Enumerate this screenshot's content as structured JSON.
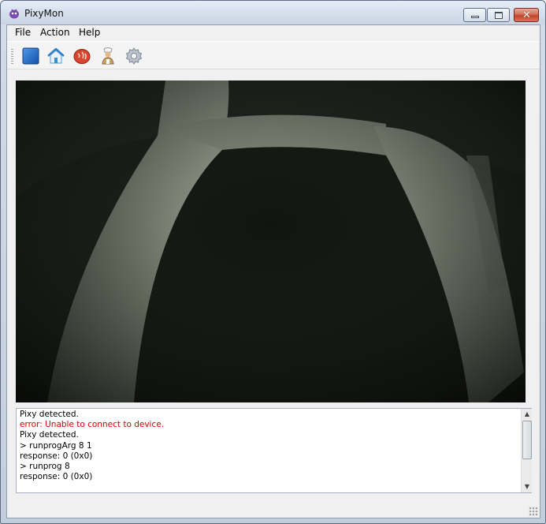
{
  "window": {
    "title": "PixyMon",
    "controls": {
      "minimize": "minimize",
      "maximize": "maximize",
      "close": "close"
    }
  },
  "menu": {
    "items": [
      "File",
      "Action",
      "Help"
    ]
  },
  "toolbar": {
    "buttons": [
      {
        "icon": "stop-square-icon",
        "color": "#1f6fc8"
      },
      {
        "icon": "home-icon",
        "color": "#3a9ad9"
      },
      {
        "icon": "steak-icon",
        "color": "#d9462f"
      },
      {
        "icon": "chef-icon",
        "color": "#c9a36a"
      },
      {
        "icon": "gear-icon",
        "color": "#8c96a3"
      }
    ]
  },
  "console": {
    "lines": [
      {
        "text": "Pixy detected.",
        "type": "normal"
      },
      {
        "text": "error: Unable to connect to device.",
        "type": "error"
      },
      {
        "text": "Pixy detected.",
        "type": "normal"
      },
      {
        "text": "> runprogArg 8 1",
        "type": "normal"
      },
      {
        "text": "response: 0 (0x0)",
        "type": "normal"
      },
      {
        "text": "> runprog 8",
        "type": "normal"
      },
      {
        "text": "response: 0 (0x0)",
        "type": "normal"
      }
    ],
    "error_color": "#d40000"
  },
  "colors": {
    "accent": "#1f6fc8",
    "video_bg": "#0f110d",
    "track_band": "#9fa59a"
  }
}
